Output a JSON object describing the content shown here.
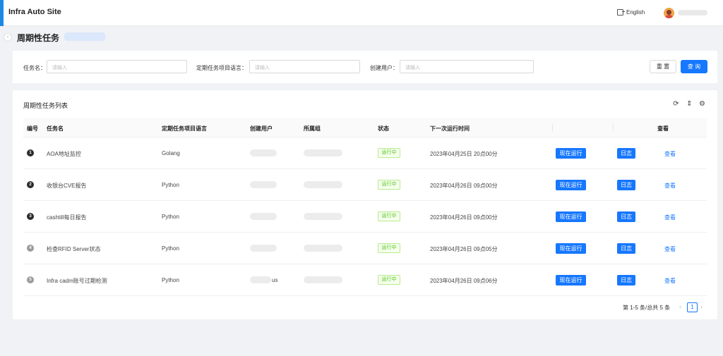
{
  "app": {
    "title": "Infra Auto Site"
  },
  "header": {
    "language": "English",
    "lang_icon": "language-switch-icon",
    "avatar_icon": "user-avatar"
  },
  "page": {
    "title": "周期性任务",
    "sidebar_toggle": "‹"
  },
  "filters": {
    "task_name_label": "任务名：",
    "task_name_placeholder": "请输入",
    "language_label": "定期任务项目语言：",
    "language_placeholder": "请输入",
    "creator_label": "创建用户：",
    "creator_placeholder": "请输入",
    "reset_label": "重 置",
    "query_label": "查 询"
  },
  "list": {
    "title": "周期性任务列表",
    "toolbar": {
      "refresh_icon": "⟳",
      "density_icon": "⇕",
      "settings_icon": "⚙"
    },
    "columns": [
      "编号",
      "任务名",
      "定期任务项目语言",
      "创建用户",
      "所属组",
      "状态",
      "下一次运行时间",
      "查看"
    ],
    "rows": [
      {
        "no": "1",
        "name": "AOA地址监控",
        "lang": "Golang",
        "creator_visible": "",
        "status": "运行中",
        "next_run": "2023年04月25日 20点00分",
        "run_label": "现在运行",
        "log_label": "日志",
        "view_label": "查看"
      },
      {
        "no": "2",
        "name": "收银台CVE报告",
        "lang": "Python",
        "creator_visible": "",
        "status": "运行中",
        "next_run": "2023年04月26日 09点00分",
        "run_label": "现在运行",
        "log_label": "日志",
        "view_label": "查看"
      },
      {
        "no": "3",
        "name": "cashtill每日报告",
        "lang": "Python",
        "creator_visible": "",
        "status": "运行中",
        "next_run": "2023年04月26日 09点00分",
        "run_label": "现在运行",
        "log_label": "日志",
        "view_label": "查看"
      },
      {
        "no": "4",
        "name": "检查RFID Server状态",
        "lang": "Python",
        "creator_visible": "",
        "status": "运行中",
        "next_run": "2023年04月26日 09点05分",
        "run_label": "现在运行",
        "log_label": "日志",
        "view_label": "查看"
      },
      {
        "no": "5",
        "name": "Infra cadm账号过期检测",
        "lang": "Python",
        "creator_visible": "us",
        "status": "运行中",
        "next_run": "2023年04月26日 09点06分",
        "run_label": "现在运行",
        "log_label": "日志",
        "view_label": "查看"
      }
    ]
  },
  "pagination": {
    "summary": "第 1-5 条/总共 5 条",
    "current_page": "1",
    "prev": "‹",
    "next": "›"
  }
}
